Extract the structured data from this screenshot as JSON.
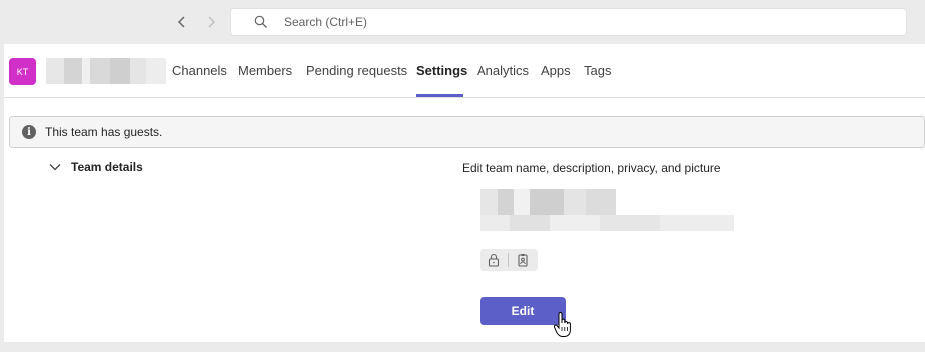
{
  "topbar": {
    "back_icon": "chevron-left-icon",
    "forward_icon": "chevron-right-icon",
    "search_placeholder": "Search (Ctrl+E)"
  },
  "team": {
    "avatar_initials": "KT",
    "avatar_color": "#d02fc8"
  },
  "tabs": [
    {
      "label": "Channels",
      "active": false
    },
    {
      "label": "Members",
      "active": false
    },
    {
      "label": "Pending requests",
      "active": false
    },
    {
      "label": "Settings",
      "active": true
    },
    {
      "label": "Analytics",
      "active": false
    },
    {
      "label": "Apps",
      "active": false
    },
    {
      "label": "Tags",
      "active": false
    }
  ],
  "banner": {
    "icon": "info-icon",
    "text": "This team has guests."
  },
  "team_details": {
    "section_title": "Team details",
    "expanded": true,
    "edit_description": "Edit team name, description, privacy, and picture",
    "privacy_icons": [
      "lock-icon",
      "id-badge-icon"
    ],
    "edit_button_label": "Edit"
  },
  "colors": {
    "accent": "#5b5fc7"
  }
}
